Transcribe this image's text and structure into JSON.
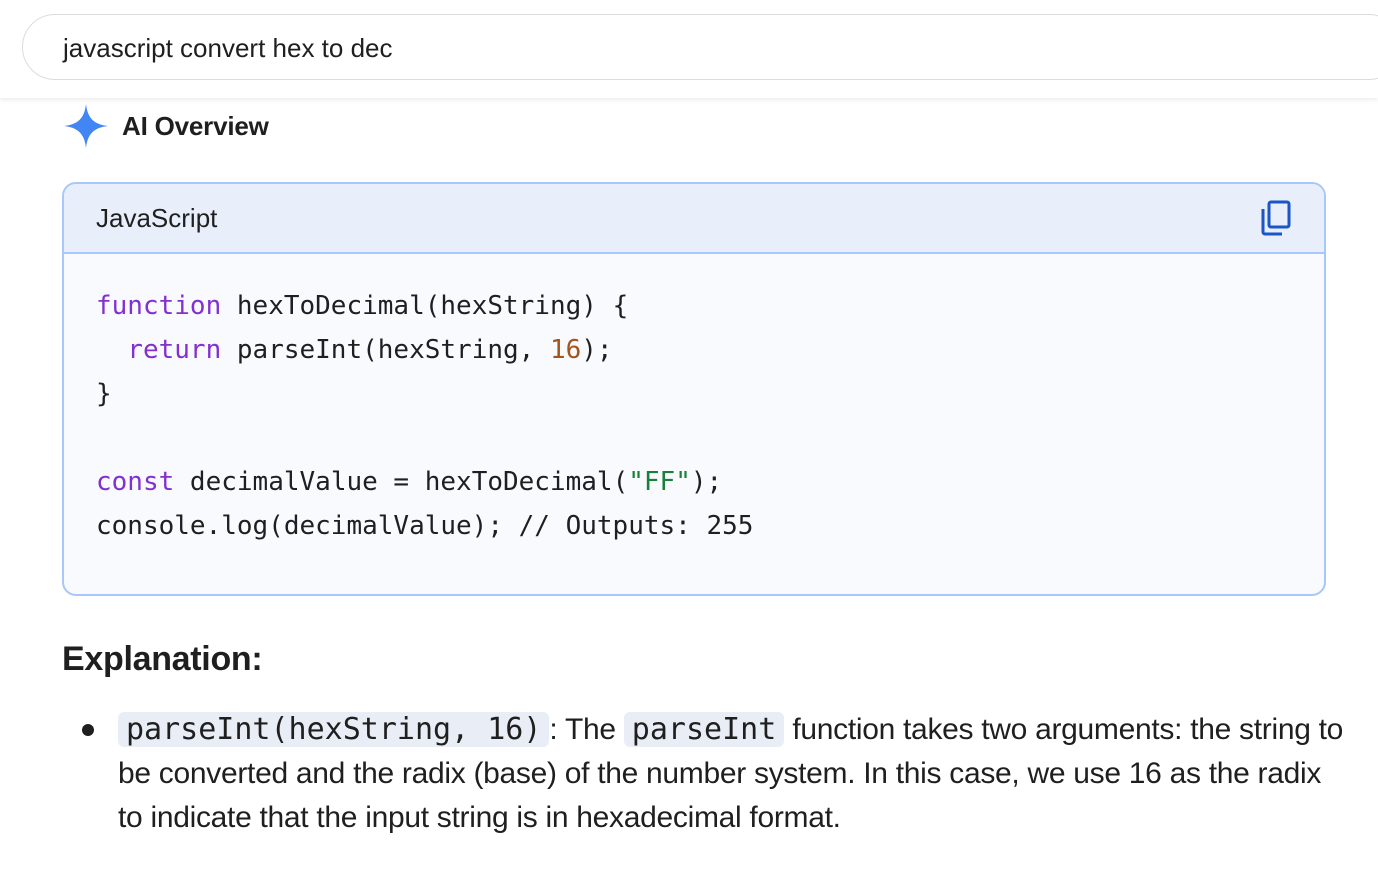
{
  "search": {
    "query": "javascript convert hex to dec"
  },
  "ai_overview": {
    "title": "AI Overview",
    "icon": "sparkle-icon",
    "accent_color": "#4285f4"
  },
  "code_block": {
    "language": "JavaScript",
    "copy_icon": "copy-icon",
    "lines": [
      [
        {
          "t": "function",
          "c": "kw"
        },
        {
          "t": " hexToDecimal(hexString) {",
          "c": ""
        }
      ],
      [
        {
          "t": "  ",
          "c": ""
        },
        {
          "t": "return",
          "c": "kw"
        },
        {
          "t": " parseInt(hexString, ",
          "c": ""
        },
        {
          "t": "16",
          "c": "num"
        },
        {
          "t": ");",
          "c": ""
        }
      ],
      [
        {
          "t": "}",
          "c": ""
        }
      ],
      [],
      [
        {
          "t": "const",
          "c": "kw"
        },
        {
          "t": " decimalValue = hexToDecimal(",
          "c": ""
        },
        {
          "t": "\"FF\"",
          "c": "str"
        },
        {
          "t": ");",
          "c": ""
        }
      ],
      [
        {
          "t": "console.log(decimalValue); // Outputs: 255",
          "c": ""
        }
      ]
    ],
    "colors": {
      "keyword": "#8430ce",
      "number": "#a3551d",
      "string": "#188038"
    }
  },
  "explanation": {
    "title": "Explanation:",
    "bullets": [
      {
        "code1": "parseInt(hexString, 16)",
        "text1": ": The ",
        "code2": "parseInt",
        "text2": " function takes two arguments: the string to be converted and the radix (base) of the number system. In this case, we use 16 as the radix to indicate that the input string is in hexadecimal format."
      }
    ]
  }
}
